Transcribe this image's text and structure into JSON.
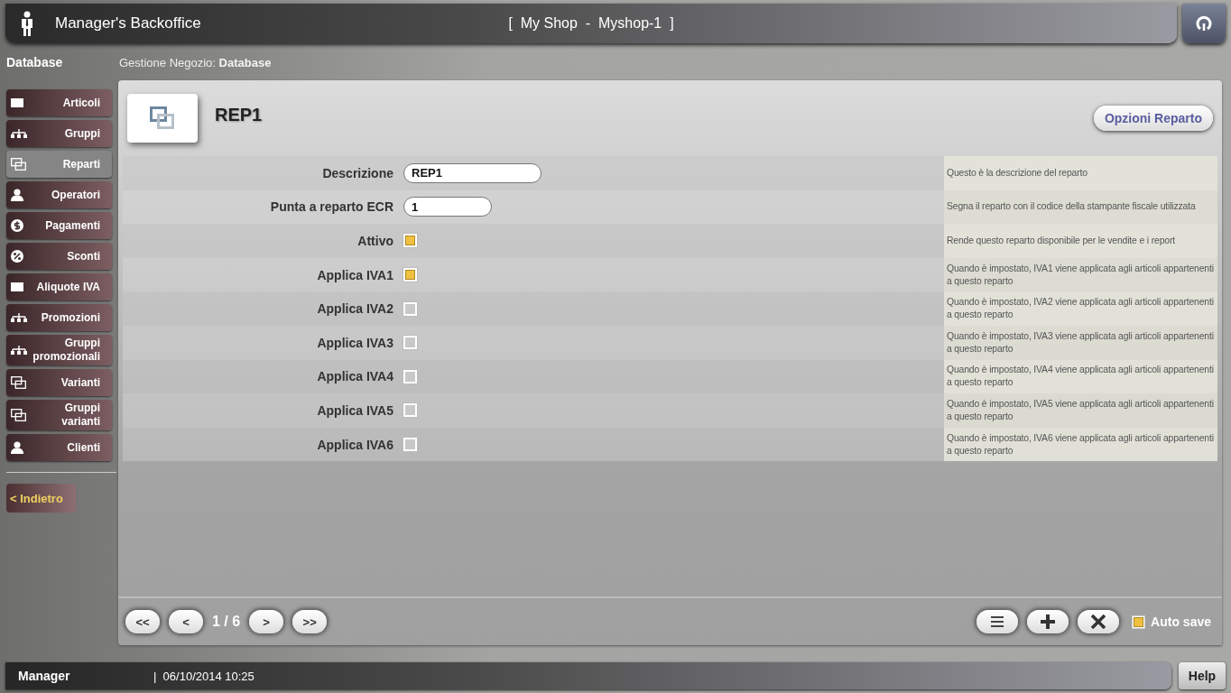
{
  "header": {
    "title": "Manager's Backoffice",
    "shop": "[  My Shop  -  Myshop-1  ]"
  },
  "sidebar": {
    "title": "Database",
    "items": [
      {
        "label": "Articoli",
        "kind": "square",
        "selected": false
      },
      {
        "label": "Gruppi",
        "kind": "tree",
        "selected": false
      },
      {
        "label": "Reparti",
        "kind": "windows",
        "selected": true
      },
      {
        "label": "Operatori",
        "kind": "person",
        "selected": false
      },
      {
        "label": "Pagamenti",
        "kind": "coin",
        "selected": false
      },
      {
        "label": "Sconti",
        "kind": "discount",
        "selected": false
      },
      {
        "label": "Aliquote IVA",
        "kind": "square",
        "selected": false
      },
      {
        "label": "Promozioni",
        "kind": "tree",
        "selected": false
      },
      {
        "label": "Gruppi promozionali",
        "kind": "tree",
        "selected": false
      },
      {
        "label": "Varianti",
        "kind": "windows",
        "selected": false
      },
      {
        "label": "Gruppi varianti",
        "kind": "windows",
        "selected": false
      },
      {
        "label": "Clienti",
        "kind": "person",
        "selected": false
      }
    ],
    "back": "< Indietro"
  },
  "breadcrumb": {
    "prefix": "Gestione Negozio:",
    "current": "Database"
  },
  "record": {
    "title": "REP1",
    "options_button": "Opzioni Reparto"
  },
  "fields": [
    {
      "kind": "text",
      "label": "Descrizione",
      "value": "REP1",
      "hint": "Questo è la descrizione del reparto"
    },
    {
      "kind": "text",
      "label": "Punta a reparto ECR",
      "value": "1",
      "hint": "Segna il reparto con il codice della stampante fiscale utilizzata"
    },
    {
      "kind": "checkbox",
      "label": "Attivo",
      "checked": true,
      "hint": "Rende questo reparto disponibile per le vendite e i report"
    },
    {
      "kind": "checkbox",
      "label": "Applica IVA1",
      "checked": true,
      "hint": "Quando è impostato, IVA1 viene applicata agli articoli appartenenti a questo reparto"
    },
    {
      "kind": "checkbox",
      "label": "Applica IVA2",
      "checked": false,
      "hint": "Quando è impostato, IVA2 viene applicata agli articoli appartenenti a questo reparto"
    },
    {
      "kind": "checkbox",
      "label": "Applica IVA3",
      "checked": false,
      "hint": "Quando è impostato, IVA3 viene applicata agli articoli appartenenti a questo reparto"
    },
    {
      "kind": "checkbox",
      "label": "Applica IVA4",
      "checked": false,
      "hint": "Quando è impostato, IVA4 viene applicata agli articoli appartenenti a questo reparto"
    },
    {
      "kind": "checkbox",
      "label": "Applica IVA5",
      "checked": false,
      "hint": "Quando è impostato, IVA5 viene applicata agli articoli appartenenti a questo reparto"
    },
    {
      "kind": "checkbox",
      "label": "Applica IVA6",
      "checked": false,
      "hint": "Quando è impostato, IVA6 viene applicata agli articoli appartenenti a questo reparto"
    }
  ],
  "pager": {
    "first": "<<",
    "prev": "<",
    "position": "1 / 6",
    "next": ">",
    "last": ">>"
  },
  "auto_save": {
    "label": "Auto save",
    "checked": true
  },
  "status_bar": {
    "user": "Manager",
    "datetime": "|  06/10/2014 10:25",
    "help": "Help"
  }
}
